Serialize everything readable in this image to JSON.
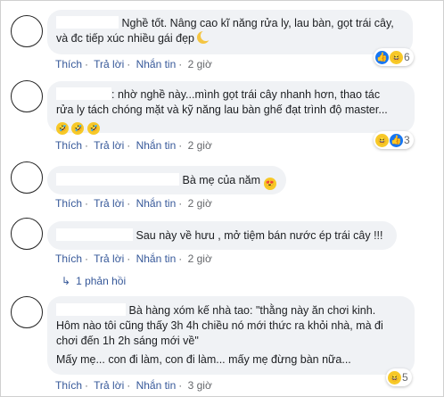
{
  "actions": {
    "like": "Thích",
    "reply": "Trả lời",
    "message": "Nhắn tin",
    "time": "2 giờ",
    "time_3": "3 giờ"
  },
  "comments": [
    {
      "text_line1": "Nghề tốt. Nâng cao kĩ năng rửa ly, lau bàn, gọt trái cây,",
      "text_line2": "và đc tiếp xúc nhiều gái đẹp",
      "reaction_count": "6",
      "reaction_icons": [
        "like-icon",
        "haha-icon"
      ]
    },
    {
      "text_line1": ": nhờ nghề này...mình gọt trái cây nhanh hơn, thao tác",
      "text_line2": "rửa ly tách chóng mặt và kỹ năng lau bàn ghế đạt trình độ master...",
      "reaction_count": "3",
      "reaction_icons": [
        "haha-icon",
        "like-icon"
      ]
    },
    {
      "text_line1": "Bà mẹ của năm"
    },
    {
      "text_line1": "Sau này về hưu , mở tiệm bán nước ép trái cây !!!",
      "replies_label": "1 phản hồi"
    },
    {
      "text_line1": "Bà hàng xóm kế nhà tao: \"thằng này ăn chơi kinh.",
      "text_line2": "Hôm nào tôi cũng thấy 3h 4h chiều nó mới thức ra khỏi nhà, mà đi",
      "text_line3": "chơi đến 1h 2h sáng mới về\"",
      "text_line4": "Mấy mẹ... con đi làm, con đi làm... mấy mẹ đừng bàn nữa...",
      "reaction_count": "5",
      "reaction_icons": [
        "haha-icon"
      ]
    }
  ]
}
